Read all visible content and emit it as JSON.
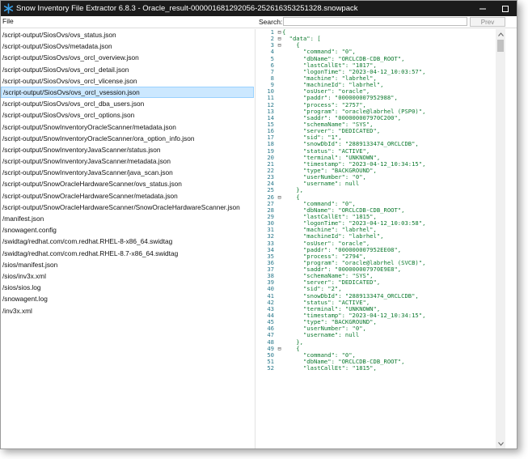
{
  "window": {
    "title": "Snow Inventory File Extractor 6.8.3 - Oracle_result-000001681292056-252616353251328.snowpack"
  },
  "toolbar": {
    "file_menu": "File",
    "search_label": "Search:",
    "search_value": "",
    "prev_label": "Prev"
  },
  "files": [
    "/script-output/SiosOvs/ovs_status.json",
    "/script-output/SiosOvs/metadata.json",
    "/script-output/SiosOvs/ovs_orcl_overview.json",
    "/script-output/SiosOvs/ovs_orcl_detail.json",
    "/script-output/SiosOvs/ovs_orcl_vlicense.json",
    "/script-output/SiosOvs/ovs_orcl_vsession.json",
    "/script-output/SiosOvs/ovs_orcl_dba_users.json",
    "/script-output/SiosOvs/ovs_orcl_options.json",
    "/script-output/SnowInventoryOracleScanner/metadata.json",
    "/script-output/SnowInventoryOracleScanner/ora_option_info.json",
    "/script-output/SnowInventoryJavaScanner/status.json",
    "/script-output/SnowInventoryJavaScanner/metadata.json",
    "/script-output/SnowInventoryJavaScanner/java_scan.json",
    "/script-output/SnowOracleHardwareScanner/ovs_status.json",
    "/script-output/SnowOracleHardwareScanner/metadata.json",
    "/script-output/SnowOracleHardwareScanner/SnowOracleHardwareScanner.json",
    "/manifest.json",
    "/snowagent.config",
    "/swidtag/redhat.com/com.redhat.RHEL-8-x86_64.swidtag",
    "/swidtag/redhat.com/com.redhat.RHEL-8.7-x86_64.swidtag",
    "/sios/manifest.json",
    "/sios/inv3x.xml",
    "/sios/sios.log",
    "/snowagent.log",
    "/inv3x.xml"
  ],
  "selected_file_index": 5,
  "code_lines": [
    {
      "n": "1",
      "fold": "⊟",
      "text": "{"
    },
    {
      "n": "2",
      "fold": "⊟",
      "text": "  \"data\": ["
    },
    {
      "n": "3",
      "fold": "⊟",
      "text": "    {"
    },
    {
      "n": "4",
      "fold": "",
      "text": "      \"command\": \"0\","
    },
    {
      "n": "5",
      "fold": "",
      "text": "      \"dbName\": \"ORCLCDB-CDB_ROOT\","
    },
    {
      "n": "6",
      "fold": "",
      "text": "      \"lastCallEt\": \"1817\","
    },
    {
      "n": "7",
      "fold": "",
      "text": "      \"logonTime\": \"2023-04-12_10:03:57\","
    },
    {
      "n": "8",
      "fold": "",
      "text": "      \"machine\": \"labrhel\","
    },
    {
      "n": "9",
      "fold": "",
      "text": "      \"machineId\": \"labrhel\","
    },
    {
      "n": "10",
      "fold": "",
      "text": "      \"osUser\": \"oracle\","
    },
    {
      "n": "11",
      "fold": "",
      "text": "      \"paddr\": \"000000007952988\","
    },
    {
      "n": "12",
      "fold": "",
      "text": "      \"process\": \"2757\","
    },
    {
      "n": "13",
      "fold": "",
      "text": "      \"program\": \"oracle@labrhel (PSP0)\","
    },
    {
      "n": "14",
      "fold": "",
      "text": "      \"saddr\": \"000000007970C200\","
    },
    {
      "n": "15",
      "fold": "",
      "text": "      \"schemaName\": \"SYS\","
    },
    {
      "n": "16",
      "fold": "",
      "text": "      \"server\": \"DEDICATED\","
    },
    {
      "n": "17",
      "fold": "",
      "text": "      \"sid\": \"1\","
    },
    {
      "n": "18",
      "fold": "",
      "text": "      \"snowDbId\": \"2889133474_ORCLCDB\","
    },
    {
      "n": "19",
      "fold": "",
      "text": "      \"status\": \"ACTIVE\","
    },
    {
      "n": "20",
      "fold": "",
      "text": "      \"terminal\": \"UNKNOWN\","
    },
    {
      "n": "21",
      "fold": "",
      "text": "      \"timestamp\": \"2023-04-12_10:34:15\","
    },
    {
      "n": "22",
      "fold": "",
      "text": "      \"type\": \"BACKGROUND\","
    },
    {
      "n": "23",
      "fold": "",
      "text": "      \"userNumber\": \"0\","
    },
    {
      "n": "24",
      "fold": "",
      "text": "      \"username\": null"
    },
    {
      "n": "25",
      "fold": "",
      "text": "    },"
    },
    {
      "n": "26",
      "fold": "⊟",
      "text": "    {"
    },
    {
      "n": "27",
      "fold": "",
      "text": "      \"command\": \"0\","
    },
    {
      "n": "28",
      "fold": "",
      "text": "      \"dbName\": \"ORCLCDB-CDB_ROOT\","
    },
    {
      "n": "29",
      "fold": "",
      "text": "      \"lastCallEt\": \"1815\","
    },
    {
      "n": "30",
      "fold": "",
      "text": "      \"logonTime\": \"2023-04-12_10:03:58\","
    },
    {
      "n": "31",
      "fold": "",
      "text": "      \"machine\": \"labrhel\","
    },
    {
      "n": "32",
      "fold": "",
      "text": "      \"machineId\": \"labrhel\","
    },
    {
      "n": "33",
      "fold": "",
      "text": "      \"osUser\": \"oracle\","
    },
    {
      "n": "34",
      "fold": "",
      "text": "      \"paddr\": \"000000007952EE08\","
    },
    {
      "n": "35",
      "fold": "",
      "text": "      \"process\": \"2794\","
    },
    {
      "n": "36",
      "fold": "",
      "text": "      \"program\": \"oracle@labrhel (SVCB)\","
    },
    {
      "n": "37",
      "fold": "",
      "text": "      \"saddr\": \"000000007970E9E8\","
    },
    {
      "n": "38",
      "fold": "",
      "text": "      \"schemaName\": \"SYS\","
    },
    {
      "n": "39",
      "fold": "",
      "text": "      \"server\": \"DEDICATED\","
    },
    {
      "n": "40",
      "fold": "",
      "text": "      \"sid\": \"2\","
    },
    {
      "n": "41",
      "fold": "",
      "text": "      \"snowDbId\": \"2889133474_ORCLCDB\","
    },
    {
      "n": "42",
      "fold": "",
      "text": "      \"status\": \"ACTIVE\","
    },
    {
      "n": "43",
      "fold": "",
      "text": "      \"terminal\": \"UNKNOWN\","
    },
    {
      "n": "44",
      "fold": "",
      "text": "      \"timestamp\": \"2023-04-12_10:34:15\","
    },
    {
      "n": "45",
      "fold": "",
      "text": "      \"type\": \"BACKGROUND\","
    },
    {
      "n": "46",
      "fold": "",
      "text": "      \"userNumber\": \"0\","
    },
    {
      "n": "47",
      "fold": "",
      "text": "      \"username\": null"
    },
    {
      "n": "48",
      "fold": "",
      "text": "    },"
    },
    {
      "n": "49",
      "fold": "⊟",
      "text": "    {"
    },
    {
      "n": "50",
      "fold": "",
      "text": "      \"command\": \"0\","
    },
    {
      "n": "51",
      "fold": "",
      "text": "      \"dbName\": \"ORCLCDB-CDB_ROOT\","
    },
    {
      "n": "52",
      "fold": "",
      "text": "      \"lastCallEt\": \"1815\","
    }
  ],
  "colors": {
    "titlebar": "#1b1b1b",
    "selection": "#cce8ff",
    "json_text": "#0e7a2f",
    "line_number": "#2b7a8c",
    "app_icon": "#3aa0e8"
  },
  "icons": {
    "app": "snowflake-icon",
    "minimize": "minimize-icon",
    "maximize": "maximize-icon",
    "scroll_up": "chevron-up-icon",
    "scroll_down": "chevron-down-icon"
  }
}
